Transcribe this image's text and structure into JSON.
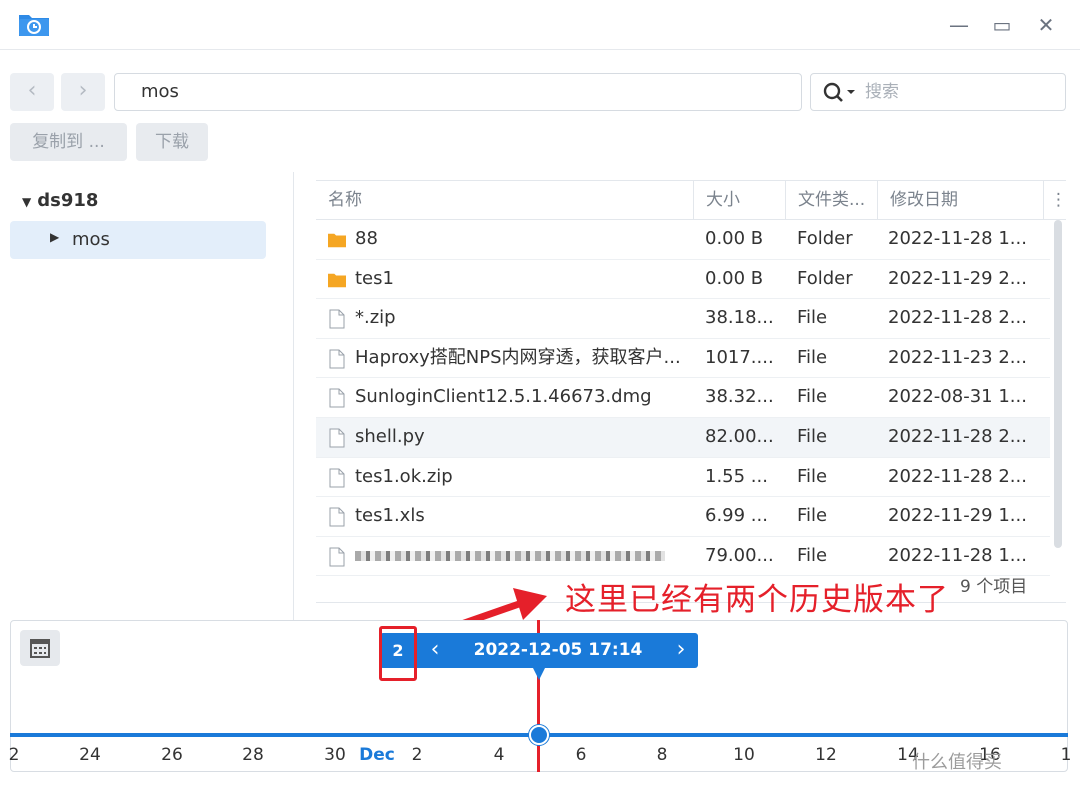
{
  "window": {
    "minimize_glyph": "—",
    "maximize_glyph": "▭",
    "close_glyph": "✕"
  },
  "nav": {
    "back_glyph": "‹",
    "forward_glyph": "›"
  },
  "path": {
    "value": "mos"
  },
  "search": {
    "placeholder": "搜索"
  },
  "toolbar": {
    "copy_to": "复制到 ...",
    "download": "下载"
  },
  "tree": {
    "root": "ds918",
    "child": "mos"
  },
  "table": {
    "columns": [
      "名称",
      "大小",
      "文件类...",
      "修改日期"
    ],
    "rows": [
      {
        "name": "88",
        "size": "0.00 B",
        "type": "Folder",
        "date": "2022-11-28 1...",
        "icon": "folder-icon"
      },
      {
        "name": "tes1",
        "size": "0.00 B",
        "type": "Folder",
        "date": "2022-11-29 2...",
        "icon": "folder-icon"
      },
      {
        "name": "*.zip",
        "size": "38.18...",
        "type": "File",
        "date": "2022-11-28 2...",
        "icon": "file-icon"
      },
      {
        "name": "Haproxy搭配NPS内网穿透，获取客户...",
        "size": "1017....",
        "type": "File",
        "date": "2022-11-23 2...",
        "icon": "file-icon"
      },
      {
        "name": "SunloginClient12.5.1.46673.dmg",
        "size": "38.32...",
        "type": "File",
        "date": "2022-08-31 1...",
        "icon": "file-icon"
      },
      {
        "name": "shell.py",
        "size": "82.00...",
        "type": "File",
        "date": "2022-11-28 2...",
        "icon": "file-icon"
      },
      {
        "name": "tes1.ok.zip",
        "size": "1.55 ...",
        "type": "File",
        "date": "2022-11-28 2...",
        "icon": "file-icon"
      },
      {
        "name": "tes1.xls",
        "size": "6.99 ...",
        "type": "File",
        "date": "2022-11-29 1...",
        "icon": "file-icon"
      },
      {
        "name": "",
        "size": "79.00...",
        "type": "File",
        "date": "2022-11-28 1...",
        "icon": "file-icon"
      }
    ],
    "item_count": "9 个项目"
  },
  "annotation": {
    "text": "这里已经有两个历史版本了"
  },
  "timeline": {
    "version_count": "2",
    "version_date": "2022-12-05 17:14",
    "prev_glyph": "‹",
    "next_glyph": "›",
    "ticks": [
      "2",
      "24",
      "26",
      "28",
      "30",
      "Dec",
      "2",
      "4",
      "6",
      "8",
      "10",
      "12",
      "14",
      "16",
      "1"
    ]
  },
  "watermark": "什么值得买",
  "colors": {
    "accent": "#1a7ad9",
    "annotation": "#e5202a",
    "folder": "#f5a623"
  }
}
